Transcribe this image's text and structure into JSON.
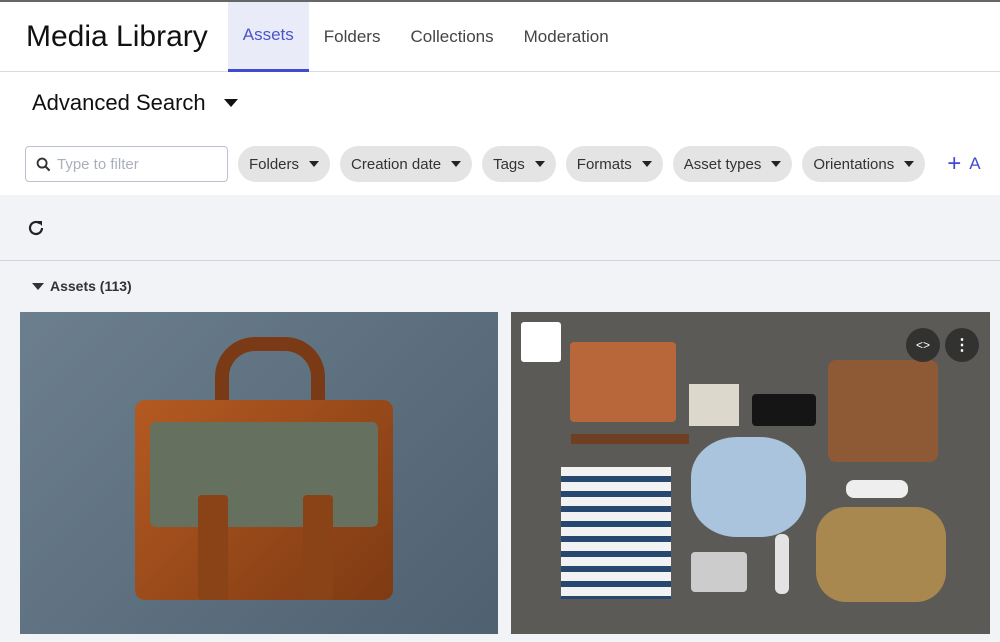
{
  "header": {
    "title": "Media Library",
    "tabs": [
      {
        "label": "Assets",
        "active": true
      },
      {
        "label": "Folders"
      },
      {
        "label": "Collections"
      },
      {
        "label": "Moderation"
      }
    ]
  },
  "search": {
    "title": "Advanced Search",
    "placeholder": "Type to filter",
    "value": ""
  },
  "filters": [
    "Folders",
    "Creation date",
    "Tags",
    "Formats",
    "Asset types",
    "Orientations"
  ],
  "add_filter_label": "A",
  "toolbar": {
    "refresh_icon": "refresh-icon"
  },
  "assets": {
    "heading": "Assets (113)",
    "items": [
      {
        "image": "leather briefcase on blue-grey background"
      },
      {
        "image": "flat lay of travel items on grey carpet"
      }
    ]
  },
  "colors": {
    "accent": "#3f4bd0",
    "tab_active_bg": "#e9ebf8",
    "chip_bg": "#e4e4e4",
    "panel_bg": "#f1f3f7"
  }
}
